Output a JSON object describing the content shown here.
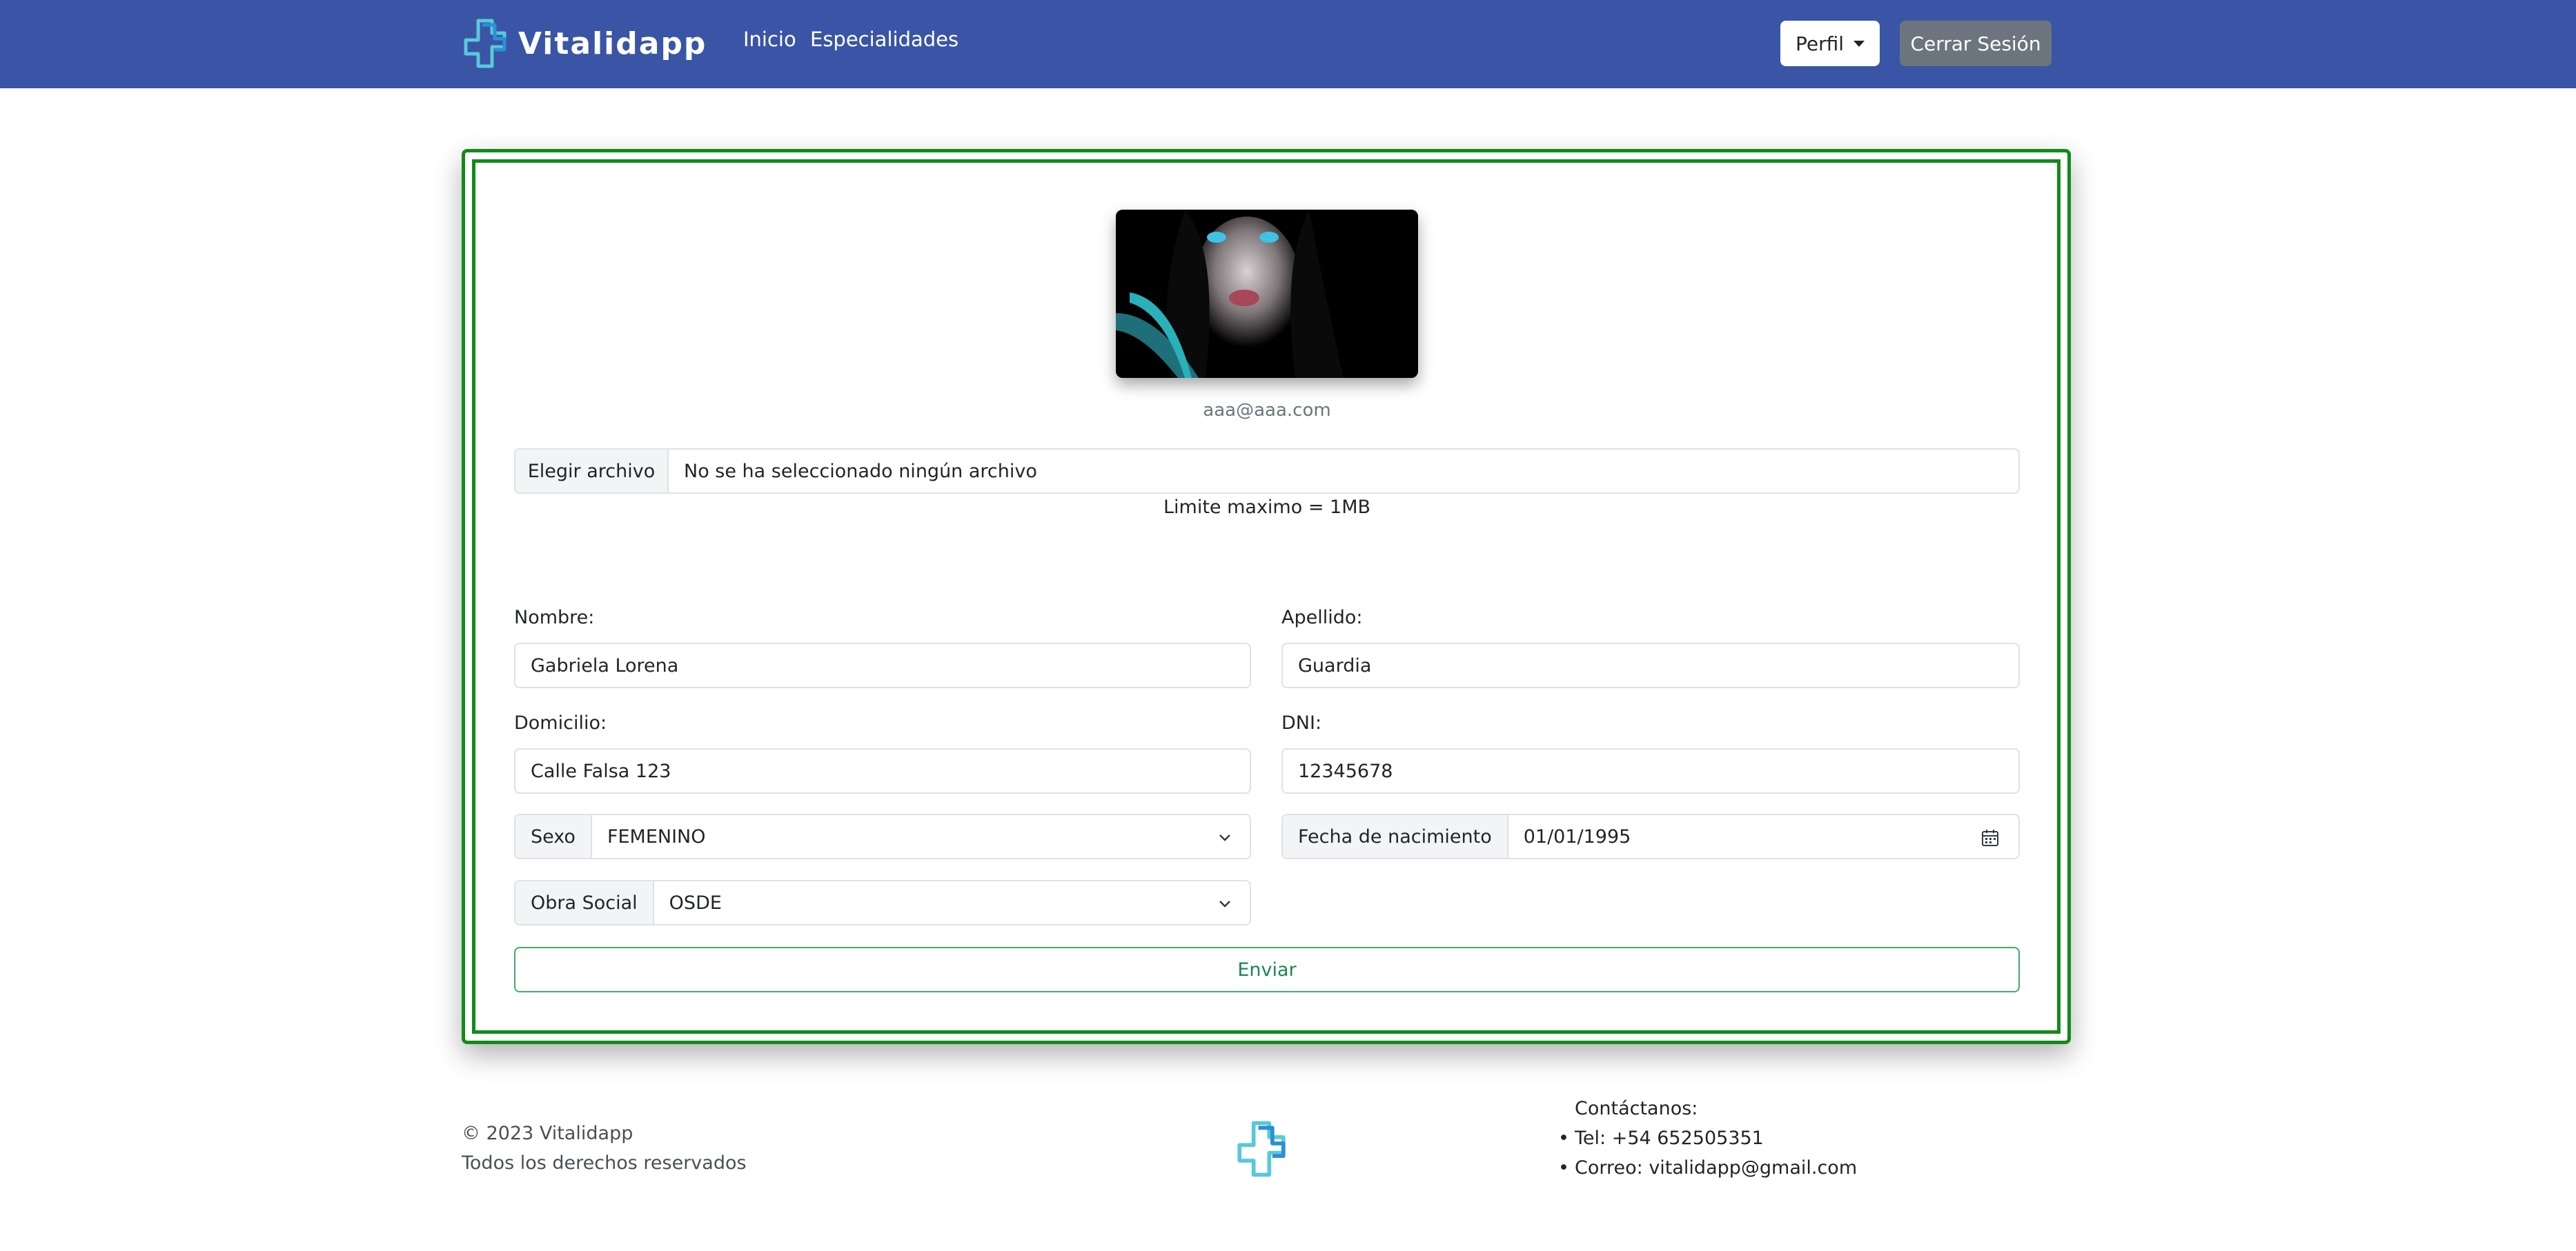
{
  "app": {
    "brand_name": "Vitalidapp",
    "brand_color": "#3a55a5",
    "accent_green": "#138a1a"
  },
  "navbar": {
    "logo_icon": "medical-cross-logo",
    "links": [
      "Inicio",
      "Especialidades"
    ],
    "profile_button": "Perfil",
    "logout_button": "Cerrar Sesión"
  },
  "profile": {
    "avatar_icon": "profile-photo",
    "email": "aaa@aaa.com"
  },
  "file_upload": {
    "button_label": "Elegir archivo",
    "status_text": "No se ha seleccionado ningún archivo",
    "limit_text": "Limite maximo = 1MB"
  },
  "form": {
    "nombre": {
      "label": "Nombre:",
      "value": "Gabriela Lorena"
    },
    "apellido": {
      "label": "Apellido:",
      "value": "Guardia"
    },
    "domicilio": {
      "label": "Domicilio:",
      "value": "Calle Falsa 123"
    },
    "dni": {
      "label": "DNI:",
      "value": "12345678"
    },
    "sexo": {
      "label": "Sexo",
      "value": "FEMENINO"
    },
    "fecha": {
      "label": "Fecha de nacimiento",
      "value": "01/01/1995"
    },
    "obra_social": {
      "label": "Obra Social",
      "value": "OSDE"
    },
    "submit_label": "Enviar"
  },
  "footer": {
    "copyright": "© 2023 Vitalidapp",
    "rights": "Todos los derechos reservados",
    "contact_title": "Contáctanos:",
    "contact_items": [
      "Tel: +54 652505351",
      "Correo: vitalidapp@gmail.com"
    ]
  }
}
